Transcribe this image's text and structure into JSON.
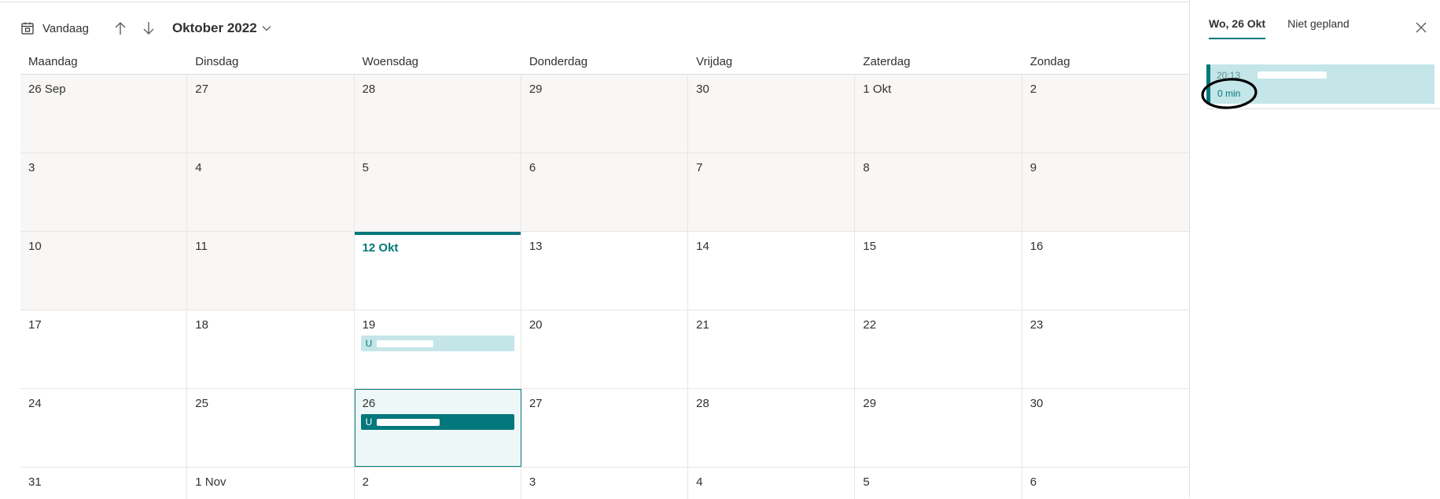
{
  "toolbar": {
    "today_label": "Vandaag",
    "month_label": "Oktober 2022"
  },
  "weekdays": [
    "Maandag",
    "Dinsdag",
    "Woensdag",
    "Donderdag",
    "Vrijdag",
    "Zaterdag",
    "Zondag"
  ],
  "weeks": [
    [
      "26 Sep",
      "27",
      "28",
      "29",
      "30",
      "1 Okt",
      "2"
    ],
    [
      "3",
      "4",
      "5",
      "6",
      "7",
      "8",
      "9"
    ],
    [
      "10",
      "11",
      "12 Okt",
      "13",
      "14",
      "15",
      "16"
    ],
    [
      "17",
      "18",
      "19",
      "20",
      "21",
      "22",
      "23"
    ],
    [
      "24",
      "25",
      "26",
      "27",
      "28",
      "29",
      "30"
    ],
    [
      "31",
      "1 Nov",
      "2",
      "3",
      "4",
      "5",
      "6"
    ]
  ],
  "events": {
    "oct19": {
      "label": "U",
      "style": "light"
    },
    "oct26": {
      "label": "U",
      "style": "dark"
    }
  },
  "panel": {
    "tabs": [
      "Wo, 26 Okt",
      "Niet gepland"
    ],
    "active_tab": "Wo, 26 Okt",
    "card": {
      "time": "20:13",
      "duration": "0 min"
    }
  },
  "colors": {
    "accent": "#03787c",
    "event_light": "#c4e6e8",
    "past_bg": "#f8f7f6",
    "annotation": "#000000"
  }
}
